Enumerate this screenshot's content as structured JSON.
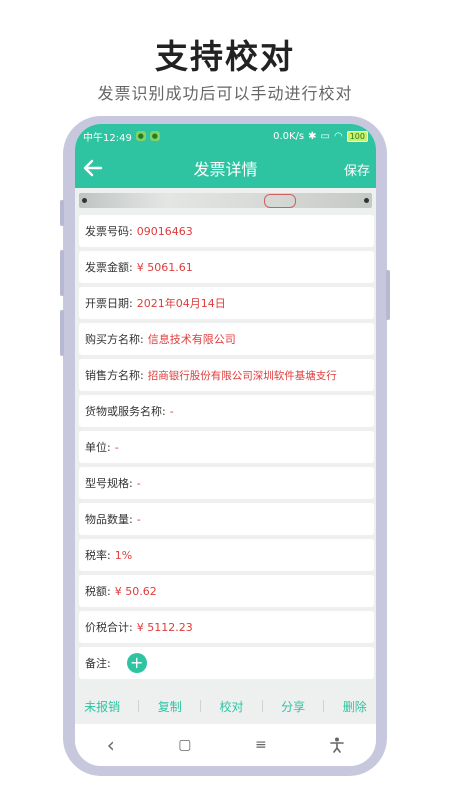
{
  "promo": {
    "title": "支持校对",
    "subtitle": "发票识别成功后可以手动进行校对"
  },
  "status_bar": {
    "time": "中午12:49",
    "network_speed": "0.0K/s",
    "battery": "100"
  },
  "app_bar": {
    "title": "发票详情",
    "save_label": "保存",
    "back_icon": "arrow-left-icon"
  },
  "fields": [
    {
      "label": "发票号码:",
      "value": "09016463"
    },
    {
      "label": "发票金额:",
      "value": "¥ 5061.61"
    },
    {
      "label": "开票日期:",
      "value": "2021年04月14日"
    },
    {
      "label": "购买方名称:",
      "value": "信息技术有限公司"
    },
    {
      "label": "销售方名称:",
      "value": "招商银行股份有限公司深圳软件基塘支行"
    },
    {
      "label": "货物或服务名称:",
      "value": "-"
    },
    {
      "label": "单位:",
      "value": "-"
    },
    {
      "label": "型号规格:",
      "value": "-"
    },
    {
      "label": "物品数量:",
      "value": "-"
    },
    {
      "label": "税率:",
      "value": "1%"
    },
    {
      "label": "税额:",
      "value": "¥ 50.62"
    },
    {
      "label": "价税合计:",
      "value": "¥ 5112.23"
    },
    {
      "label": "备注:",
      "value": ""
    }
  ],
  "actions": {
    "unreimbursed": "未报销",
    "copy": "复制",
    "proofread": "校对",
    "share": "分享",
    "delete": "删除"
  },
  "nav": {
    "back": "‹",
    "home": "▢",
    "menu": "≡"
  },
  "colors": {
    "accent": "#2ec4a2",
    "value_red": "#e03b3b",
    "frame": "#c7c8dd"
  }
}
